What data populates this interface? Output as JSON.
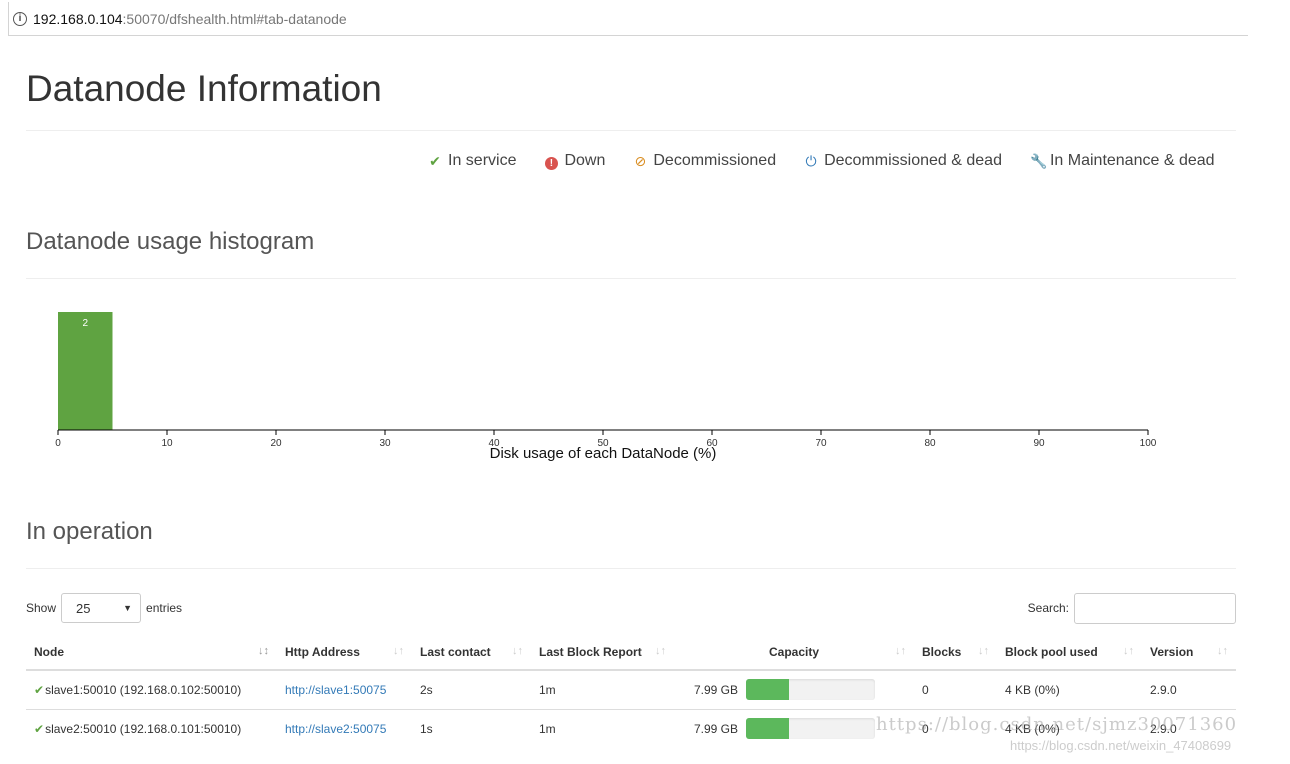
{
  "browser": {
    "url_host": "192.168.0.104",
    "url_rest": ":50070/dfshealth.html#tab-datanode"
  },
  "page": {
    "title": "Datanode Information"
  },
  "legend": [
    {
      "label": "In service",
      "icon": "check-icon"
    },
    {
      "label": "Down",
      "icon": "exclamation-circle-icon"
    },
    {
      "label": "Decommissioned",
      "icon": "ban-icon"
    },
    {
      "label": "Decommissioned & dead",
      "icon": "power-icon"
    },
    {
      "label": "In Maintenance & dead",
      "icon": "wrench-icon"
    }
  ],
  "histogram": {
    "heading": "Datanode usage histogram",
    "chart_data": {
      "type": "bar",
      "bins": [
        [
          0,
          5
        ]
      ],
      "values": [
        2
      ],
      "xlabel": "Disk usage of each DataNode (%)",
      "xlim": [
        0,
        100
      ],
      "xticks": [
        0,
        10,
        20,
        30,
        40,
        50,
        60,
        70,
        80,
        90,
        100
      ],
      "bar_color": "#5fa341"
    }
  },
  "operation": {
    "heading": "In operation",
    "show_label": "Show",
    "page_size": "25",
    "entries_label": "entries",
    "search_label": "Search:",
    "columns": [
      "Node",
      "Http Address",
      "Last contact",
      "Last Block Report",
      "Capacity",
      "Blocks",
      "Block pool used",
      "Version"
    ],
    "rows": [
      {
        "node": "slave1:50010 (192.168.0.102:50010)",
        "http": "http://slave1:50075",
        "last_contact": "2s",
        "last_block_report": "1m",
        "capacity": "7.99 GB",
        "capacity_used_pct": 33,
        "blocks": "0",
        "block_pool_used": "4 KB (0%)",
        "version": "2.9.0"
      },
      {
        "node": "slave2:50010 (192.168.0.101:50010)",
        "http": "http://slave2:50075",
        "last_contact": "1s",
        "last_block_report": "1m",
        "capacity": "7.99 GB",
        "capacity_used_pct": 33,
        "blocks": "0",
        "block_pool_used": "4 KB (0%)",
        "version": "2.9.0"
      }
    ]
  },
  "watermark": {
    "line1": "https://blog.csdn.net/sjmz30071360",
    "line2": "https://blog.csdn.net/weixin_47408699"
  },
  "colors": {
    "accent": "#5fa341",
    "link": "#337ab7",
    "progress": "#5cb85c"
  }
}
